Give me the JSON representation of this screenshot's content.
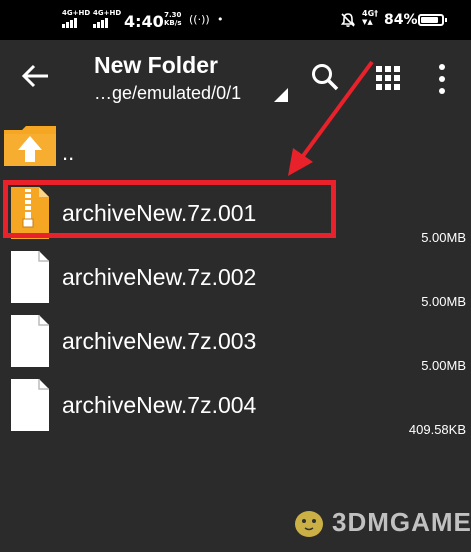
{
  "status_bar": {
    "sim1": "4G+HD",
    "sim2": "4G+HD",
    "time": "4:40",
    "speed_value": "7.30",
    "speed_unit": "KB/s",
    "network": "4G†",
    "battery_percent": "84%",
    "battery_level": 0.84
  },
  "toolbar": {
    "title": "New Folder",
    "path": "…ge/emulated/0/1"
  },
  "parent_item": {
    "label": ".."
  },
  "files": [
    {
      "name": "archiveNew.7z.001",
      "size": "5.00MB",
      "icon": "zip-file-icon"
    },
    {
      "name": "archiveNew.7z.002",
      "size": "5.00MB",
      "icon": "file-icon"
    },
    {
      "name": "archiveNew.7z.003",
      "size": "5.00MB",
      "icon": "file-icon"
    },
    {
      "name": "archiveNew.7z.004",
      "size": "409.58KB",
      "icon": "file-icon"
    }
  ],
  "colors": {
    "background": "#2b2b2b",
    "highlight": "#e8212a",
    "folder": "#f5a623"
  },
  "watermark": {
    "text": "3DMGAME"
  }
}
